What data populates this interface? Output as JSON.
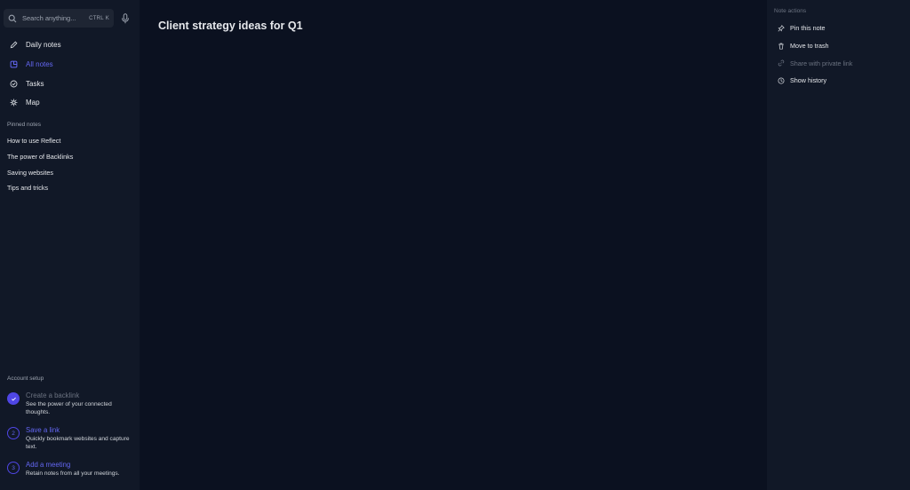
{
  "search": {
    "placeholder": "Search anything...",
    "shortcut": "CTRL K"
  },
  "nav": [
    {
      "label": "Daily notes",
      "icon": "pencil-icon",
      "active": false
    },
    {
      "label": "All notes",
      "icon": "notes-icon",
      "active": true
    },
    {
      "label": "Tasks",
      "icon": "check-circle-icon",
      "active": false
    },
    {
      "label": "Map",
      "icon": "network-icon",
      "active": false
    }
  ],
  "pinned": {
    "label": "Pinned notes",
    "items": [
      "How to use Reflect",
      "The power of Backlinks",
      "Saving websites",
      "Tips and tricks"
    ]
  },
  "setup": {
    "label": "Account setup",
    "items": [
      {
        "step": "",
        "title": "Create a backlink",
        "desc": "See the power of your connected thoughts.",
        "done": true
      },
      {
        "step": "2",
        "title": "Save a link",
        "desc": "Quickly bookmark websites and capture text.",
        "done": false
      },
      {
        "step": "3",
        "title": "Add a meeting",
        "desc": "Retain notes from all your meetings.",
        "done": false
      }
    ]
  },
  "note": {
    "title": "Client strategy ideas for Q1"
  },
  "actions": {
    "label": "Note actions",
    "items": [
      {
        "label": "Pin this note",
        "icon": "pin-icon",
        "disabled": false
      },
      {
        "label": "Move to trash",
        "icon": "trash-icon",
        "disabled": false
      },
      {
        "label": "Share with private link",
        "icon": "link-icon",
        "disabled": true
      },
      {
        "label": "Show history",
        "icon": "clock-icon",
        "disabled": false
      }
    ]
  },
  "colors": {
    "accent": "#6366f1",
    "sidebar_bg": "#111827",
    "main_bg": "#0b1120"
  }
}
